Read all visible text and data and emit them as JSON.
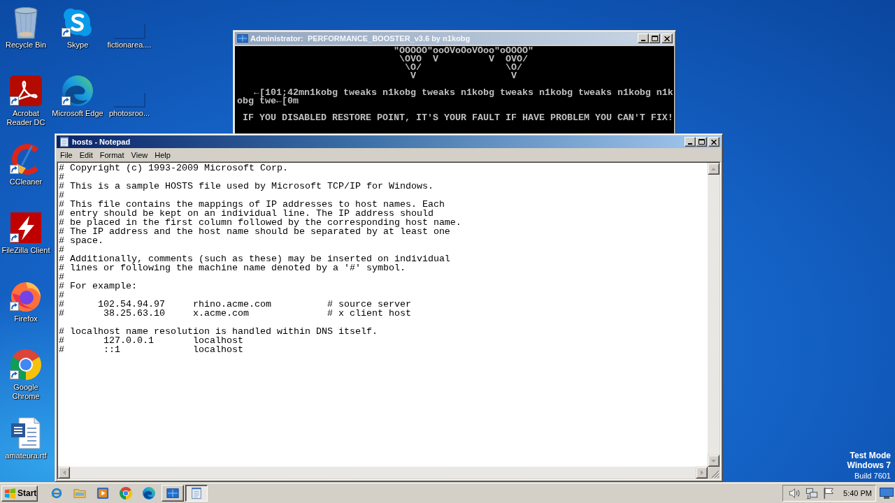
{
  "desktop": {
    "icon_columns": [
      [
        {
          "label": "Recycle Bin",
          "kind": "recycle",
          "shortcut": false
        },
        {
          "label": "Acrobat Reader DC",
          "kind": "acrobat",
          "shortcut": true
        },
        {
          "label": "CCleaner",
          "kind": "ccleaner",
          "shortcut": true
        },
        {
          "label": "FileZilla Client",
          "kind": "filezilla",
          "shortcut": true
        },
        {
          "label": "Firefox",
          "kind": "firefox",
          "shortcut": true
        },
        {
          "label": "Google Chrome",
          "kind": "chrome",
          "shortcut": true
        },
        {
          "label": "amateura.rtf",
          "kind": "word",
          "shortcut": false
        }
      ],
      [
        {
          "label": "Skype",
          "kind": "skype",
          "shortcut": true
        },
        {
          "label": "Microsoft Edge",
          "kind": "edge",
          "shortcut": true
        }
      ],
      [
        {
          "label": "fictionarea....",
          "kind": "blank",
          "shortcut": false
        },
        {
          "label": "photosroo...",
          "kind": "blank",
          "shortcut": false
        }
      ]
    ]
  },
  "console_window": {
    "title": "Administrator:  PERFORMANCE_BOOSTER_v3.6 by n1kobg",
    "active": false,
    "output": [
      [
        "                            \"OOOOO\"ooOVoOoVOoo\"oOOOO\"",
        "                             \\OVO  V         V  OVO/",
        "                              \\O/               \\O/",
        "                               V                 V"
      ],
      [
        "   ←[101;42mn1kobg tweaks n1kobg tweaks n1kobg tweaks n1kobg tweaks n1kobg n1k",
        "obg twe←[0m"
      ],
      [
        " IF YOU DISABLED RESTORE POINT, IT'S YOUR FAULT IF HAVE PROBLEM YOU CAN'T FIX!"
      ]
    ]
  },
  "notepad_window": {
    "title": "hosts - Notepad",
    "active": true,
    "menu": [
      "File",
      "Edit",
      "Format",
      "View",
      "Help"
    ],
    "text": [
      [
        "# Copyright (c) 1993-2009 Microsoft Corp.",
        "#",
        "# This is a sample HOSTS file used by Microsoft TCP/IP for Windows.",
        "#",
        "# This file contains the mappings of IP addresses to host names. Each",
        "# entry should be kept on an individual line. The IP address should",
        "# be placed in the first column followed by the corresponding host name.",
        "# The IP address and the host name should be separated by at least one",
        "# space.",
        "#",
        "# Additionally, comments (such as these) may be inserted on individual",
        "# lines or following the machine name denoted by a '#' symbol.",
        "#",
        "# For example:",
        "#",
        "#      102.54.94.97     rhino.acme.com          # source server",
        "#       38.25.63.10     x.acme.com              # x client host"
      ],
      [
        "# localhost name resolution is handled within DNS itself.",
        "#       127.0.0.1       localhost",
        "#       ::1             localhost"
      ]
    ]
  },
  "system_notice": {
    "mode": "Test Mode",
    "edition": "Windows 7",
    "build": "Build 7601"
  },
  "taskbar": {
    "start": "Start",
    "windows": [
      {
        "kind": "console",
        "selected": false
      },
      {
        "kind": "notepad",
        "selected": true
      }
    ],
    "clock": "5:40 PM"
  }
}
